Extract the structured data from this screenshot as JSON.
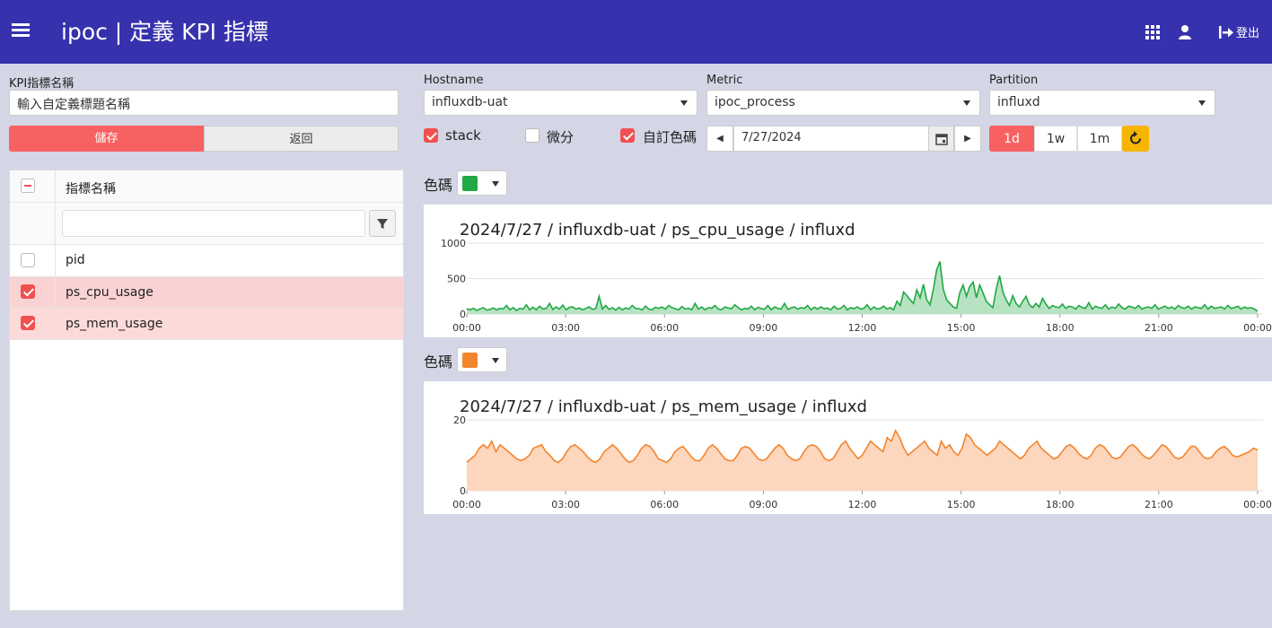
{
  "header": {
    "title": "ipoc | 定義 KPI 指標",
    "logout_label": "登出",
    "bg_color": "#3632ad"
  },
  "form": {
    "kpi_name_label": "KPI指標名稱",
    "kpi_name_placeholder": "輸入自定義標題名稱",
    "save_label": "儲存",
    "back_label": "返回"
  },
  "grid": {
    "header_label": "指標名稱",
    "filter_placeholder": "",
    "rows": [
      {
        "label": "pid",
        "checked": false
      },
      {
        "label": "ps_cpu_usage",
        "checked": true
      },
      {
        "label": "ps_mem_usage",
        "checked": true
      }
    ]
  },
  "filters": {
    "hostname_label": "Hostname",
    "hostname_value": "influxdb-uat",
    "metric_label": "Metric",
    "metric_value": "ipoc_process",
    "partition_label": "Partition",
    "partition_value": "influxd"
  },
  "options": {
    "stack_label": "stack",
    "stack_checked": true,
    "derivative_label": "微分",
    "derivative_checked": false,
    "custom_color_label": "自訂色碼",
    "custom_color_checked": true
  },
  "date": {
    "value": "7/27/2024",
    "prev_icon": "triangle-left-icon",
    "next_icon": "triangle-right-icon",
    "calendar_icon": "calendar-icon"
  },
  "range": {
    "buttons": [
      "1d",
      "1w",
      "1m"
    ],
    "active": "1d",
    "refresh_icon": "refresh-icon"
  },
  "color_label": "色碼",
  "chart_data": [
    {
      "type": "area",
      "title": "2024/7/27 / influxdb-uat / ps_cpu_usage / influxd",
      "color": "#22a845",
      "fill": "#b7e3c2",
      "x_ticks": [
        "00:00",
        "03:00",
        "06:00",
        "09:00",
        "12:00",
        "15:00",
        "18:00",
        "21:00",
        "00:00"
      ],
      "y_ticks": [
        "1000",
        "500",
        "0"
      ],
      "ylim": [
        0,
        1000
      ],
      "x_range_hours": [
        0,
        24
      ],
      "values": [
        75,
        60,
        80,
        50,
        70,
        90,
        55,
        65,
        85,
        60,
        80,
        70,
        120,
        60,
        90,
        50,
        80,
        70,
        130,
        60,
        95,
        60,
        110,
        70,
        80,
        150,
        65,
        100,
        70,
        125,
        60,
        95,
        100,
        70,
        85,
        60,
        80,
        100,
        65,
        80,
        250,
        70,
        120,
        65,
        90,
        55,
        95,
        60,
        85,
        70,
        120,
        80,
        75,
        60,
        110,
        70,
        60,
        95,
        80,
        100,
        70,
        120,
        90,
        75,
        60,
        105,
        70,
        80,
        60,
        150,
        70,
        100,
        60,
        90,
        80,
        120,
        70,
        60,
        100,
        85,
        75,
        130,
        90,
        60,
        80,
        70,
        110,
        60,
        95,
        75,
        70,
        120,
        60,
        100,
        80,
        70,
        150,
        65,
        85,
        100,
        70,
        90,
        80,
        120,
        60,
        95,
        70,
        100,
        75,
        85,
        60,
        110,
        70,
        80,
        120,
        60,
        90,
        75,
        100,
        70,
        80,
        130,
        60,
        100,
        70,
        80,
        110,
        70,
        90,
        60,
        180,
        120,
        310,
        260,
        200,
        150,
        340,
        230,
        420,
        200,
        130,
        350,
        620,
        740,
        350,
        200,
        150,
        100,
        80,
        300,
        410,
        250,
        390,
        450,
        230,
        410,
        300,
        180,
        130,
        90,
        350,
        540,
        310,
        200,
        120,
        260,
        150,
        100,
        180,
        250,
        130,
        90,
        150,
        100,
        220,
        140,
        80,
        120,
        100,
        90,
        140,
        80,
        110,
        100,
        70,
        120,
        90,
        80,
        160,
        70,
        110,
        90,
        80,
        130,
        70,
        100,
        80,
        140,
        90,
        70,
        110,
        100,
        80,
        120,
        70,
        90,
        100,
        80,
        130,
        70,
        90,
        110,
        80,
        100,
        70,
        120,
        90,
        80,
        110,
        70,
        100,
        90,
        80,
        130,
        70,
        110,
        80,
        90,
        100,
        70,
        120,
        80,
        90,
        110,
        70,
        100,
        80,
        90,
        70,
        40
      ]
    },
    {
      "type": "area",
      "title": "2024/7/27 / influxdb-uat / ps_mem_usage / influxd",
      "color": "#f3852d",
      "fill": "#fcd6bd",
      "x_ticks": [
        "00:00",
        "03:00",
        "06:00",
        "09:00",
        "12:00",
        "15:00",
        "18:00",
        "21:00",
        "00:00"
      ],
      "y_ticks": [
        "20",
        "0"
      ],
      "ylim": [
        0,
        20
      ],
      "x_range_hours": [
        0,
        24
      ],
      "values": [
        8,
        9,
        10,
        12,
        13,
        12,
        14,
        11,
        13,
        12,
        11,
        10,
        9,
        8.5,
        9,
        10,
        12,
        12.5,
        13,
        11,
        10,
        8.5,
        8,
        9,
        11,
        12.5,
        13,
        12,
        11,
        9.5,
        8.5,
        8,
        9,
        11,
        12,
        13,
        12,
        10.5,
        9,
        8,
        8.5,
        10,
        12,
        13,
        12.5,
        11,
        9,
        8.5,
        8,
        9,
        11,
        12,
        12.5,
        11,
        9.5,
        8.5,
        8.5,
        10,
        12,
        13,
        12,
        10.5,
        9,
        8.5,
        8.5,
        10,
        12,
        12.5,
        12,
        10.5,
        9,
        8.5,
        9,
        10.5,
        12,
        13,
        12,
        10,
        9,
        8.5,
        9,
        11,
        12.5,
        13,
        12.5,
        11,
        9,
        8.5,
        9,
        11,
        13,
        14,
        12,
        10.5,
        9,
        10,
        12,
        14,
        13,
        12,
        11,
        15,
        14,
        17,
        15,
        12,
        10,
        11,
        12,
        13,
        14,
        12,
        11,
        10,
        14,
        12,
        13,
        11,
        10,
        12,
        16,
        15,
        13,
        12,
        11,
        10,
        11,
        12,
        14,
        13,
        12,
        11,
        10,
        9,
        10,
        12,
        13,
        14,
        12,
        11,
        10,
        9,
        9.5,
        11,
        12.5,
        13,
        12,
        10.5,
        9.5,
        9,
        10,
        12,
        13,
        12.5,
        11,
        9.5,
        9,
        9.5,
        11,
        12.5,
        13,
        12,
        10.5,
        9.5,
        9,
        10,
        11.5,
        13,
        12.5,
        11,
        9.5,
        9,
        9.5,
        11,
        12.5,
        12.5,
        11,
        9.5,
        9,
        9.5,
        11,
        12,
        12.5,
        11.5,
        10,
        9.5,
        10,
        10.5,
        11,
        12,
        11.5
      ]
    }
  ]
}
